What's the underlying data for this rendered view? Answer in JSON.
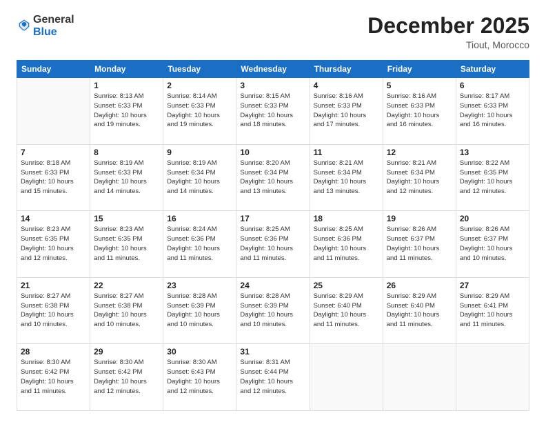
{
  "header": {
    "logo_general": "General",
    "logo_blue": "Blue",
    "month": "December 2025",
    "location": "Tiout, Morocco"
  },
  "weekdays": [
    "Sunday",
    "Monday",
    "Tuesday",
    "Wednesday",
    "Thursday",
    "Friday",
    "Saturday"
  ],
  "weeks": [
    [
      {
        "day": "",
        "info": ""
      },
      {
        "day": "1",
        "info": "Sunrise: 8:13 AM\nSunset: 6:33 PM\nDaylight: 10 hours\nand 19 minutes."
      },
      {
        "day": "2",
        "info": "Sunrise: 8:14 AM\nSunset: 6:33 PM\nDaylight: 10 hours\nand 19 minutes."
      },
      {
        "day": "3",
        "info": "Sunrise: 8:15 AM\nSunset: 6:33 PM\nDaylight: 10 hours\nand 18 minutes."
      },
      {
        "day": "4",
        "info": "Sunrise: 8:16 AM\nSunset: 6:33 PM\nDaylight: 10 hours\nand 17 minutes."
      },
      {
        "day": "5",
        "info": "Sunrise: 8:16 AM\nSunset: 6:33 PM\nDaylight: 10 hours\nand 16 minutes."
      },
      {
        "day": "6",
        "info": "Sunrise: 8:17 AM\nSunset: 6:33 PM\nDaylight: 10 hours\nand 16 minutes."
      }
    ],
    [
      {
        "day": "7",
        "info": "Sunrise: 8:18 AM\nSunset: 6:33 PM\nDaylight: 10 hours\nand 15 minutes."
      },
      {
        "day": "8",
        "info": "Sunrise: 8:19 AM\nSunset: 6:33 PM\nDaylight: 10 hours\nand 14 minutes."
      },
      {
        "day": "9",
        "info": "Sunrise: 8:19 AM\nSunset: 6:34 PM\nDaylight: 10 hours\nand 14 minutes."
      },
      {
        "day": "10",
        "info": "Sunrise: 8:20 AM\nSunset: 6:34 PM\nDaylight: 10 hours\nand 13 minutes."
      },
      {
        "day": "11",
        "info": "Sunrise: 8:21 AM\nSunset: 6:34 PM\nDaylight: 10 hours\nand 13 minutes."
      },
      {
        "day": "12",
        "info": "Sunrise: 8:21 AM\nSunset: 6:34 PM\nDaylight: 10 hours\nand 12 minutes."
      },
      {
        "day": "13",
        "info": "Sunrise: 8:22 AM\nSunset: 6:35 PM\nDaylight: 10 hours\nand 12 minutes."
      }
    ],
    [
      {
        "day": "14",
        "info": "Sunrise: 8:23 AM\nSunset: 6:35 PM\nDaylight: 10 hours\nand 12 minutes."
      },
      {
        "day": "15",
        "info": "Sunrise: 8:23 AM\nSunset: 6:35 PM\nDaylight: 10 hours\nand 11 minutes."
      },
      {
        "day": "16",
        "info": "Sunrise: 8:24 AM\nSunset: 6:36 PM\nDaylight: 10 hours\nand 11 minutes."
      },
      {
        "day": "17",
        "info": "Sunrise: 8:25 AM\nSunset: 6:36 PM\nDaylight: 10 hours\nand 11 minutes."
      },
      {
        "day": "18",
        "info": "Sunrise: 8:25 AM\nSunset: 6:36 PM\nDaylight: 10 hours\nand 11 minutes."
      },
      {
        "day": "19",
        "info": "Sunrise: 8:26 AM\nSunset: 6:37 PM\nDaylight: 10 hours\nand 11 minutes."
      },
      {
        "day": "20",
        "info": "Sunrise: 8:26 AM\nSunset: 6:37 PM\nDaylight: 10 hours\nand 10 minutes."
      }
    ],
    [
      {
        "day": "21",
        "info": "Sunrise: 8:27 AM\nSunset: 6:38 PM\nDaylight: 10 hours\nand 10 minutes."
      },
      {
        "day": "22",
        "info": "Sunrise: 8:27 AM\nSunset: 6:38 PM\nDaylight: 10 hours\nand 10 minutes."
      },
      {
        "day": "23",
        "info": "Sunrise: 8:28 AM\nSunset: 6:39 PM\nDaylight: 10 hours\nand 10 minutes."
      },
      {
        "day": "24",
        "info": "Sunrise: 8:28 AM\nSunset: 6:39 PM\nDaylight: 10 hours\nand 10 minutes."
      },
      {
        "day": "25",
        "info": "Sunrise: 8:29 AM\nSunset: 6:40 PM\nDaylight: 10 hours\nand 11 minutes."
      },
      {
        "day": "26",
        "info": "Sunrise: 8:29 AM\nSunset: 6:40 PM\nDaylight: 10 hours\nand 11 minutes."
      },
      {
        "day": "27",
        "info": "Sunrise: 8:29 AM\nSunset: 6:41 PM\nDaylight: 10 hours\nand 11 minutes."
      }
    ],
    [
      {
        "day": "28",
        "info": "Sunrise: 8:30 AM\nSunset: 6:42 PM\nDaylight: 10 hours\nand 11 minutes."
      },
      {
        "day": "29",
        "info": "Sunrise: 8:30 AM\nSunset: 6:42 PM\nDaylight: 10 hours\nand 12 minutes."
      },
      {
        "day": "30",
        "info": "Sunrise: 8:30 AM\nSunset: 6:43 PM\nDaylight: 10 hours\nand 12 minutes."
      },
      {
        "day": "31",
        "info": "Sunrise: 8:31 AM\nSunset: 6:44 PM\nDaylight: 10 hours\nand 12 minutes."
      },
      {
        "day": "",
        "info": ""
      },
      {
        "day": "",
        "info": ""
      },
      {
        "day": "",
        "info": ""
      }
    ]
  ]
}
